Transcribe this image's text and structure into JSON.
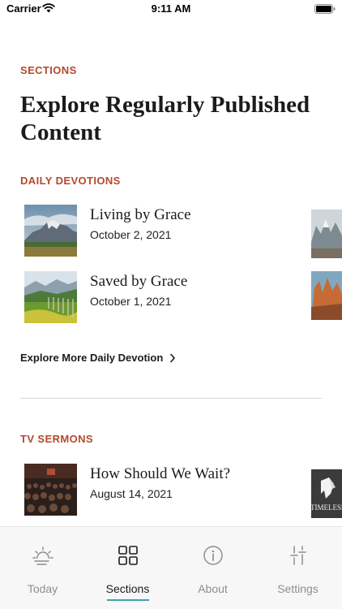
{
  "status_bar": {
    "carrier": "Carrier",
    "time": "9:11 AM"
  },
  "header": {
    "eyebrow": "SECTIONS",
    "title": "Explore Regularly Published Content"
  },
  "daily_devotions": {
    "heading": "DAILY DEVOTIONS",
    "items": [
      {
        "title": "Living by Grace",
        "date": "October 2, 2021",
        "thumb_icon": "mountain-photo"
      },
      {
        "title": "Saved by Grace",
        "date": "October 1, 2021",
        "thumb_icon": "meadow-photo"
      }
    ],
    "more_link": "Explore More Daily Devotion"
  },
  "tv_sermons": {
    "heading": "TV SERMONS",
    "items": [
      {
        "title": "How Should We Wait?",
        "date": "August 14, 2021",
        "thumb_icon": "congregation-photo"
      }
    ],
    "peek_label": "TIMELESS T"
  },
  "tab_bar": {
    "active": "Sections",
    "tabs": [
      {
        "label": "Today",
        "icon": "sunrise-icon"
      },
      {
        "label": "Sections",
        "icon": "grid-icon"
      },
      {
        "label": "About",
        "icon": "info-icon"
      },
      {
        "label": "Settings",
        "icon": "sliders-icon"
      }
    ]
  },
  "colors": {
    "accent": "#b4492d",
    "tab_indicator": "#3aa5a9",
    "text": "#1b1b1b",
    "tab_inactive": "#8e8e8e"
  }
}
